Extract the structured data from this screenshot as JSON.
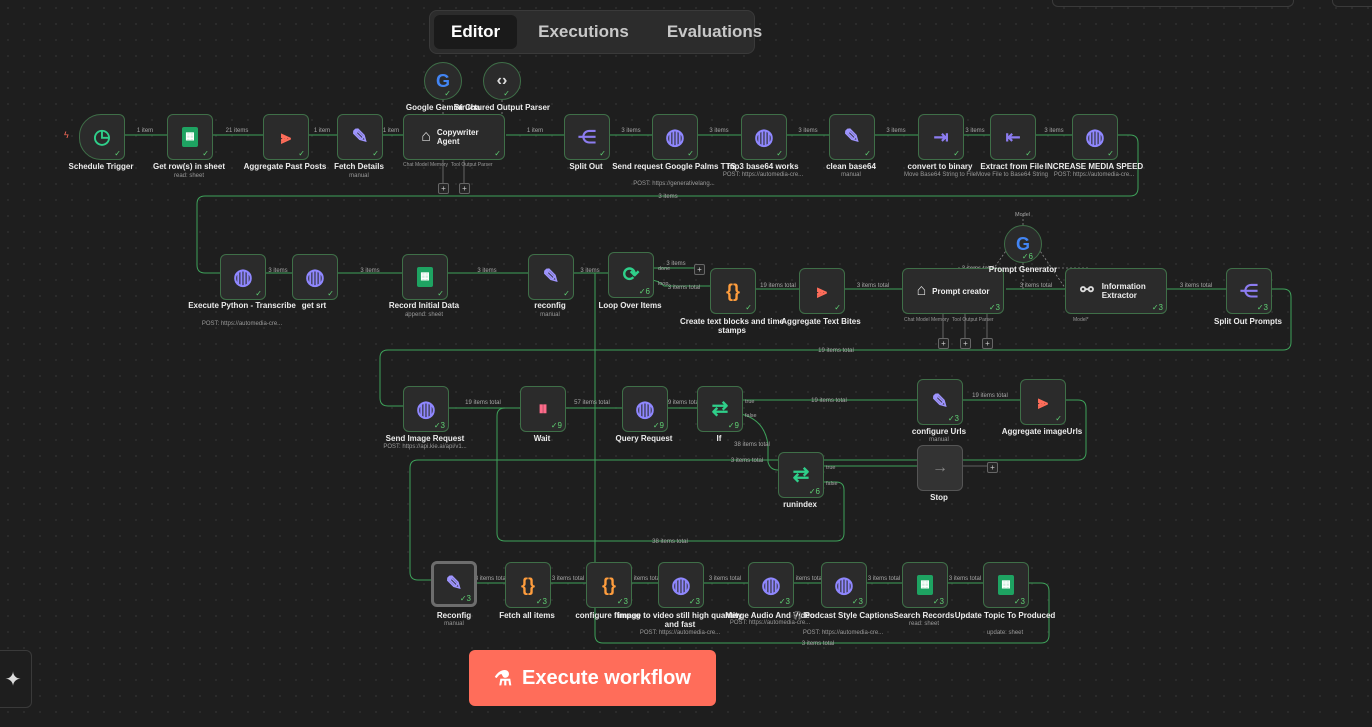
{
  "tabs": [
    "Editor",
    "Executions",
    "Evaluations"
  ],
  "active_tab": "Editor",
  "execute_button": "Execute workflow",
  "nodes": [
    {
      "id": "schedule",
      "label": "Schedule Trigger",
      "icon": "clock-icon"
    },
    {
      "id": "getrows",
      "label": "Get row(s) in sheet",
      "sub": "read: sheet",
      "icon": "sheets-icon"
    },
    {
      "id": "aggpast",
      "label": "Aggregate Past Posts",
      "icon": "aggregate-icon"
    },
    {
      "id": "fetchdetails",
      "label": "Fetch Details",
      "sub": "manual",
      "icon": "pen-icon"
    },
    {
      "id": "copywriter",
      "label": "Copywriter Agent",
      "icon": "robot-icon",
      "sub_ports": [
        "Chat Model",
        "Memory",
        "Tool",
        "Output Parser"
      ]
    },
    {
      "id": "gemini",
      "label": "Google Gemini Cha",
      "icon": "google-icon"
    },
    {
      "id": "structured",
      "label": "Structured Output Parser",
      "icon": "code-icon"
    },
    {
      "id": "splitout",
      "label": "Split Out",
      "icon": "split-icon"
    },
    {
      "id": "sendreq",
      "label": "Send request Google Palms TTS",
      "sub": "POST: https://generativelang...",
      "icon": "globe-icon"
    },
    {
      "id": "mp3",
      "label": "mp3 base64 works",
      "sub": "POST: https://automedia-cre...",
      "icon": "globe-icon"
    },
    {
      "id": "clean",
      "label": "clean base64",
      "sub": "manual",
      "icon": "pen-icon"
    },
    {
      "id": "convert",
      "label": "convert to binary",
      "sub": "Move Base64 String to File",
      "icon": "file-arrow-icon"
    },
    {
      "id": "extract",
      "label": "Extract from File",
      "sub": "Move File to Base64 String",
      "icon": "file-arrow-icon"
    },
    {
      "id": "increase",
      "label": "INCREASE MEDIA SPEED",
      "sub": "POST: https://automedia-cre...",
      "icon": "globe-icon"
    },
    {
      "id": "execpy",
      "label": "Execute Python - Transcribe",
      "sub": "POST: https://automedia-cre...",
      "icon": "globe-icon"
    },
    {
      "id": "getsrt",
      "label": "get srt",
      "icon": "globe-icon"
    },
    {
      "id": "recordinit",
      "label": "Record Initial Data",
      "sub": "append: sheet",
      "icon": "sheets-icon"
    },
    {
      "id": "reconfig1",
      "label": "reconfig",
      "sub": "manual",
      "icon": "pen-icon"
    },
    {
      "id": "loop",
      "label": "Loop Over Items",
      "icon": "loop-icon",
      "ports": [
        "done",
        "loop"
      ],
      "count": "6"
    },
    {
      "id": "createtext",
      "label": "Create text blocks and time stamps",
      "icon": "braces-icon"
    },
    {
      "id": "aggtext",
      "label": "Aggregate Text Bites",
      "icon": "aggregate-icon"
    },
    {
      "id": "promptcreator",
      "label": "Prompt creator",
      "icon": "robot-icon",
      "count": "3",
      "sub_ports": [
        "Chat Model",
        "Memory",
        "Tool",
        "Output Parser"
      ]
    },
    {
      "id": "promptgen",
      "label": "Prompt Generator",
      "icon": "google-icon",
      "count": "6",
      "top_label": "Model"
    },
    {
      "id": "infoextract",
      "label": "Information Extractor",
      "icon": "extractor-icon",
      "count": "3",
      "sub_ports": [
        "Model*"
      ]
    },
    {
      "id": "splitprompts",
      "label": "Split Out Prompts",
      "icon": "split-icon",
      "count": "3"
    },
    {
      "id": "sendimage",
      "label": "Send Image Request",
      "sub": "POST: https://api.kie.ai/api/v1...",
      "icon": "globe-icon",
      "count": "3"
    },
    {
      "id": "wait",
      "label": "Wait",
      "icon": "pause-icon",
      "count": "9"
    },
    {
      "id": "query",
      "label": "Query Request",
      "icon": "globe-icon",
      "count": "9"
    },
    {
      "id": "if",
      "label": "If",
      "icon": "if-icon",
      "count": "9",
      "ports": [
        "true",
        "false"
      ]
    },
    {
      "id": "configurls",
      "label": "configure Urls",
      "sub": "manual",
      "icon": "pen-icon",
      "count": "3"
    },
    {
      "id": "aggimages",
      "label": "Aggregate imageUrls",
      "icon": "aggregate-icon"
    },
    {
      "id": "runindex",
      "label": "runindex",
      "icon": "if-icon",
      "count": "6",
      "ports": [
        "true",
        "false"
      ]
    },
    {
      "id": "stop",
      "label": "Stop",
      "icon": "arrow-right-icon"
    },
    {
      "id": "reconfig2",
      "label": "Reconfig",
      "sub": "manual",
      "icon": "pen-icon",
      "count": "3"
    },
    {
      "id": "fetchall",
      "label": "Fetch all items",
      "icon": "braces-icon",
      "count": "3"
    },
    {
      "id": "configff",
      "label": "configure ffmpeg",
      "icon": "braces-icon",
      "count": "3"
    },
    {
      "id": "img2vid",
      "label": "image to video still high quantity and fast",
      "sub": "POST: https://automedia-cre...",
      "icon": "globe-icon",
      "count": "3"
    },
    {
      "id": "merge",
      "label": "Merge Audio And Video",
      "sub": "POST: https://automedia-cre...",
      "icon": "globe-icon",
      "count": "3"
    },
    {
      "id": "podcast",
      "label": "🎧 Podcast Style Captions",
      "sub": "POST: https://automedia-cre...",
      "icon": "globe-icon",
      "count": "3"
    },
    {
      "id": "search",
      "label": "Search Records",
      "sub": "read: sheet",
      "icon": "sheets-icon",
      "count": "3"
    },
    {
      "id": "updatetopic",
      "label": "Update Topic To Produced",
      "sub": "update: sheet",
      "icon": "sheets-icon",
      "count": "3"
    }
  ],
  "edge_labels": {
    "e1": "1 item",
    "e2": "21 items",
    "e3": "1 item",
    "e4": "1 item",
    "e5": "1 item",
    "e6": "3 items",
    "e7": "3 items",
    "e8": "3 items",
    "e9": "3 items",
    "e10": "3 items",
    "e11": "3 items",
    "e12": "3 items",
    "e13": "3 items",
    "e14": "3 items",
    "e15": "3 items",
    "e16": "3 items",
    "e17": "3 items",
    "e18": "3 items total",
    "e19": "19 items total",
    "e20": "3 items total",
    "e21": "3 items total",
    "e22": "3 items total",
    "e23": "3 items total",
    "e24": "19 items total",
    "e25": "19 items total",
    "e26": "57 items total",
    "e27": "9 items total",
    "e28": "19 items total",
    "e29": "19 items total",
    "e30": "38 items total",
    "e31": "3 items total",
    "e32": "3 items total",
    "e33": "19 items total",
    "e34": "38 items total",
    "e35": "3 items total",
    "e36": "3 items total",
    "e37": "3 items total",
    "e38": "3 items total",
    "e39": "3 items total",
    "e40": "3 items total",
    "e41": "3 items total",
    "e42": "3 items total",
    "e43": "3 items total",
    "e44": "3 items total"
  }
}
